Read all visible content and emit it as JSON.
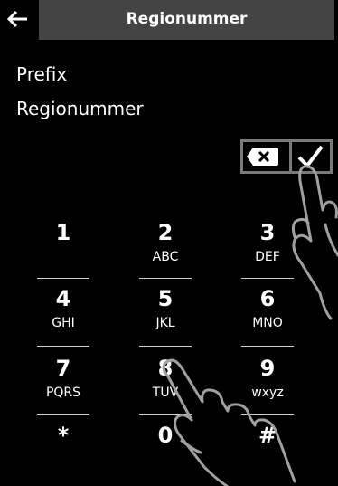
{
  "header": {
    "title": "Regionummer"
  },
  "content": {
    "line1": "Prefix",
    "line2": "Regionummer"
  },
  "keypad": {
    "keys": [
      {
        "digit": "1",
        "letters": ""
      },
      {
        "digit": "2",
        "letters": "ABC"
      },
      {
        "digit": "3",
        "letters": "DEF"
      },
      {
        "digit": "4",
        "letters": "GHI"
      },
      {
        "digit": "5",
        "letters": "JKL"
      },
      {
        "digit": "6",
        "letters": "MNO"
      },
      {
        "digit": "7",
        "letters": "PQRS"
      },
      {
        "digit": "8",
        "letters": "TUV"
      },
      {
        "digit": "9",
        "letters": "wxyz"
      },
      {
        "digit": "*",
        "letters": ""
      },
      {
        "digit": "0",
        "letters": ""
      },
      {
        "digit": "#",
        "letters": ""
      }
    ]
  },
  "icons": {
    "back": "back-arrow-icon",
    "delete": "backspace-icon",
    "confirm": "checkmark-icon",
    "hand": "pointing-hand-icon"
  }
}
